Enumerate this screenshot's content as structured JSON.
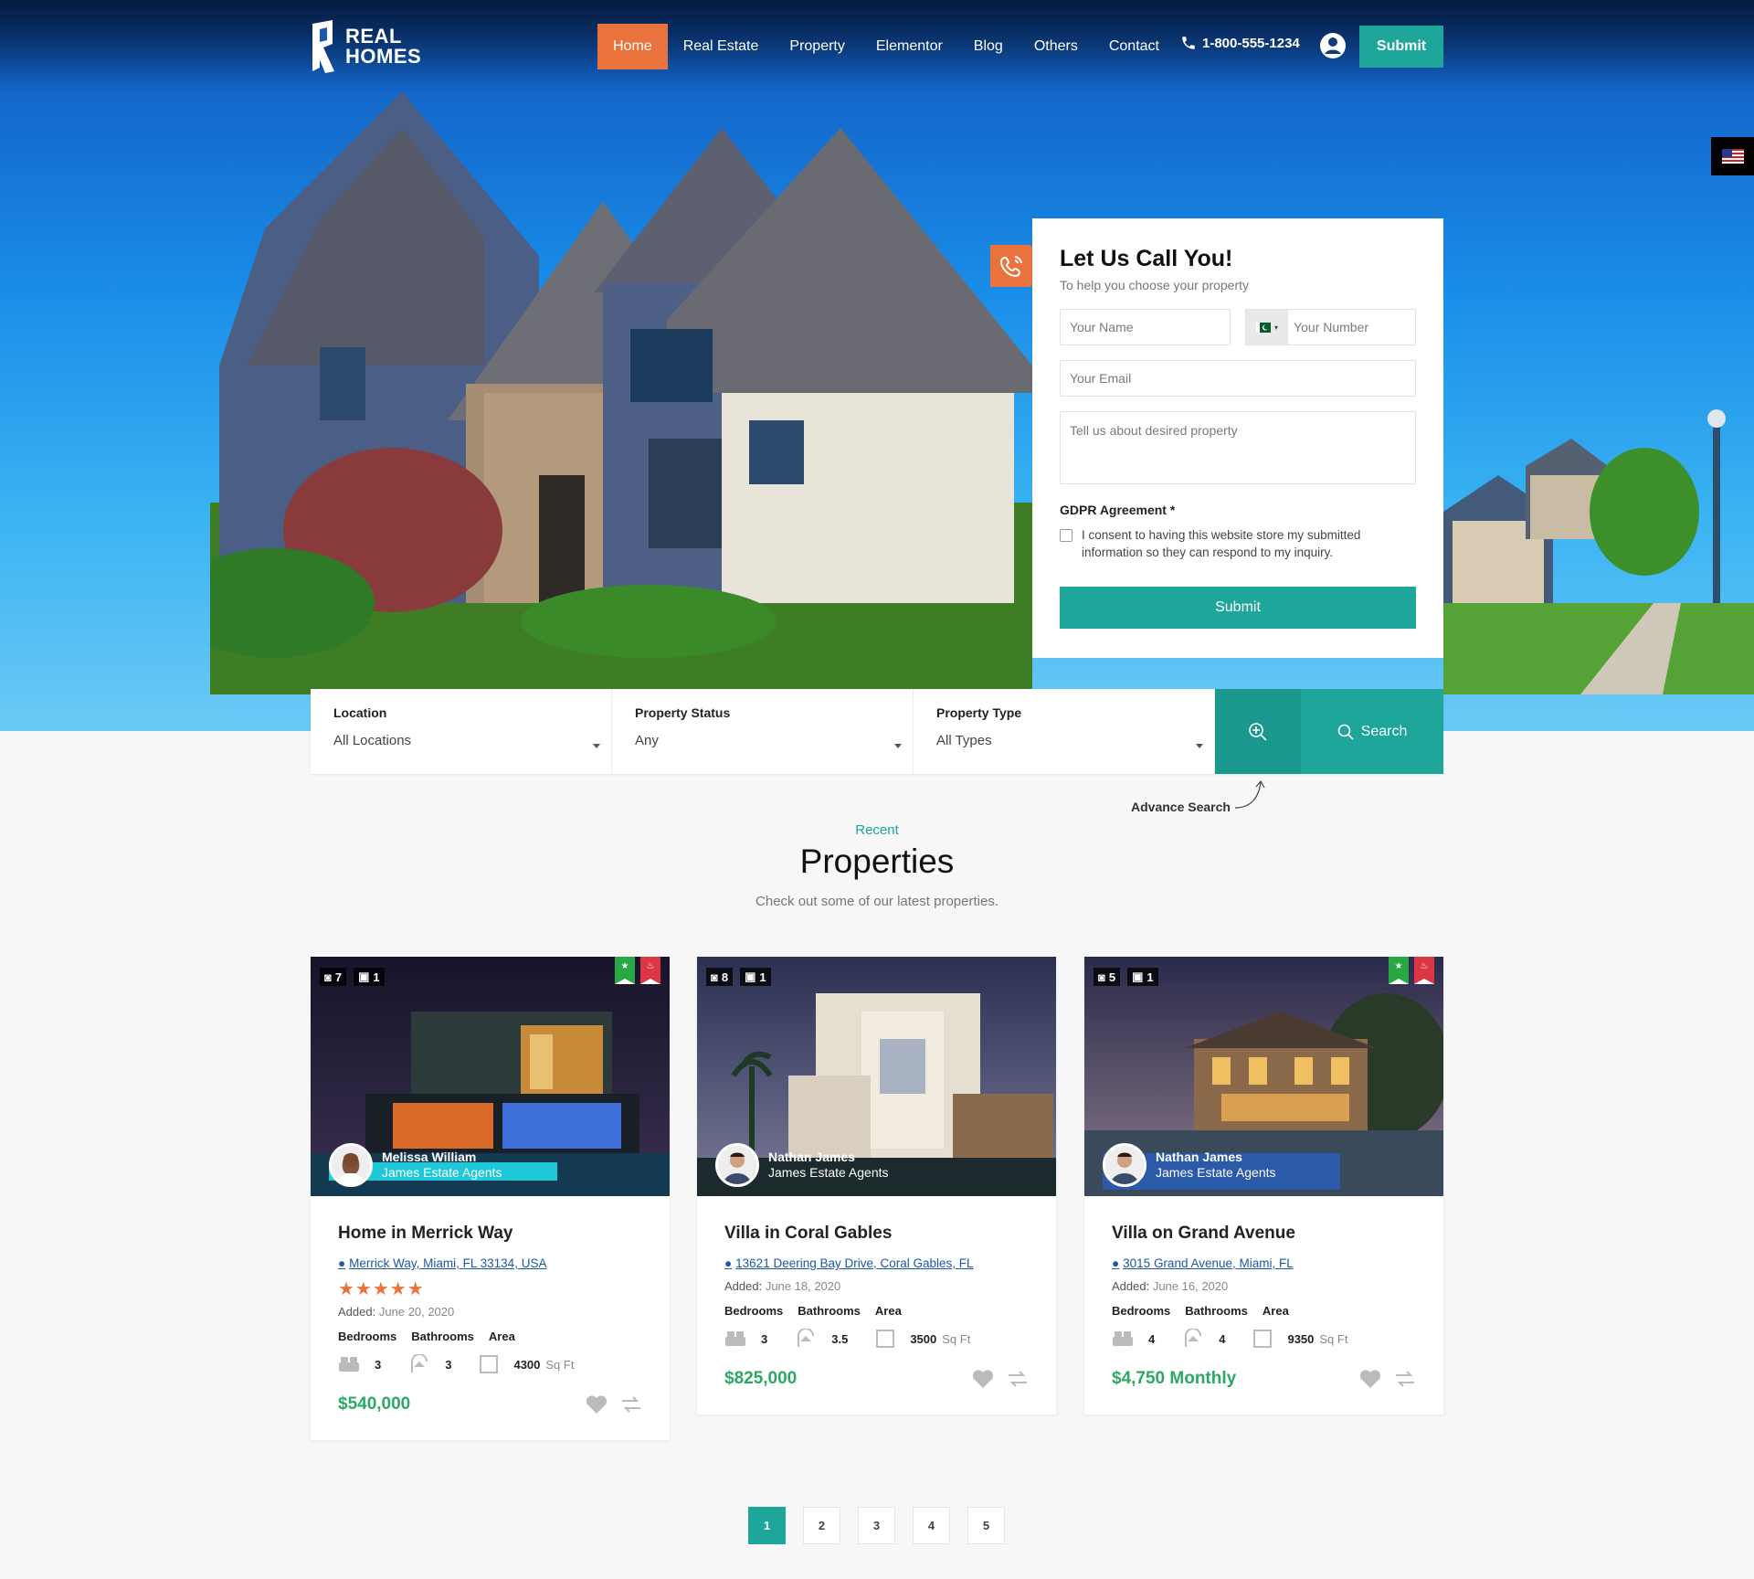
{
  "brand": {
    "line1": "REAL",
    "line2": "HOMES"
  },
  "nav": {
    "items": [
      "Home",
      "Real Estate",
      "Property",
      "Elementor",
      "Blog",
      "Others",
      "Contact"
    ],
    "active": "Home",
    "phone": "1-800-555-1234",
    "submit_label": "Submit"
  },
  "language": {
    "flag_icon": "us-flag-icon"
  },
  "call_form": {
    "title": "Let Us Call You!",
    "subtitle": "To help you choose your property",
    "name_placeholder": "Your Name",
    "number_placeholder": "Your Number",
    "email_placeholder": "Your Email",
    "message_placeholder": "Tell us about desired property",
    "gdpr_title": "GDPR Agreement *",
    "gdpr_text": "I consent to having this website store my submitted information so they can respond to my inquiry.",
    "submit_label": "Submit"
  },
  "search": {
    "fields": [
      {
        "label": "Location",
        "value": "All Locations"
      },
      {
        "label": "Property Status",
        "value": "Any"
      },
      {
        "label": "Property Type",
        "value": "All Types"
      }
    ],
    "search_label": "Search",
    "advanced_label": "Advance Search"
  },
  "section": {
    "eyebrow": "Recent",
    "title": "Properties",
    "subtitle": "Check out some of our latest properties."
  },
  "properties": [
    {
      "photos": "7",
      "videos": "1",
      "featured": true,
      "hot": true,
      "agent_name": "Melissa William",
      "agent_company": "James Estate Agents",
      "title": "Home in Merrick Way",
      "address": "Merrick Way, Miami, FL 33134, USA",
      "rating": "★★★★★",
      "added_label": "Added:",
      "added_date": "June 20, 2020",
      "bedrooms_label": "Bedrooms",
      "bathrooms_label": "Bathrooms",
      "area_label": "Area",
      "bedrooms": "3",
      "bathrooms": "3",
      "area": "4300",
      "area_unit": "Sq Ft",
      "price": "$540,000"
    },
    {
      "photos": "8",
      "videos": "1",
      "featured": false,
      "hot": false,
      "agent_name": "Nathan James",
      "agent_company": "James Estate Agents",
      "title": "Villa in Coral Gables",
      "address": "13621 Deering Bay Drive, Coral Gables, FL",
      "added_label": "Added:",
      "added_date": "June 18, 2020",
      "bedrooms_label": "Bedrooms",
      "bathrooms_label": "Bathrooms",
      "area_label": "Area",
      "bedrooms": "3",
      "bathrooms": "3.5",
      "area": "3500",
      "area_unit": "Sq Ft",
      "price": "$825,000"
    },
    {
      "photos": "5",
      "videos": "1",
      "featured": true,
      "hot": true,
      "agent_name": "Nathan James",
      "agent_company": "James Estate Agents",
      "title": "Villa on Grand Avenue",
      "address": "3015 Grand Avenue, Miami, FL",
      "added_label": "Added:",
      "added_date": "June 16, 2020",
      "bedrooms_label": "Bedrooms",
      "bathrooms_label": "Bathrooms",
      "area_label": "Area",
      "bedrooms": "4",
      "bathrooms": "4",
      "area": "9350",
      "area_unit": "Sq Ft",
      "price": "$4,750 Monthly"
    }
  ],
  "pagination": {
    "pages": [
      "1",
      "2",
      "3",
      "4",
      "5"
    ],
    "current": "1"
  },
  "colors": {
    "accent": "#1ea69a",
    "orange": "#ea723d",
    "price": "#2ca865"
  }
}
